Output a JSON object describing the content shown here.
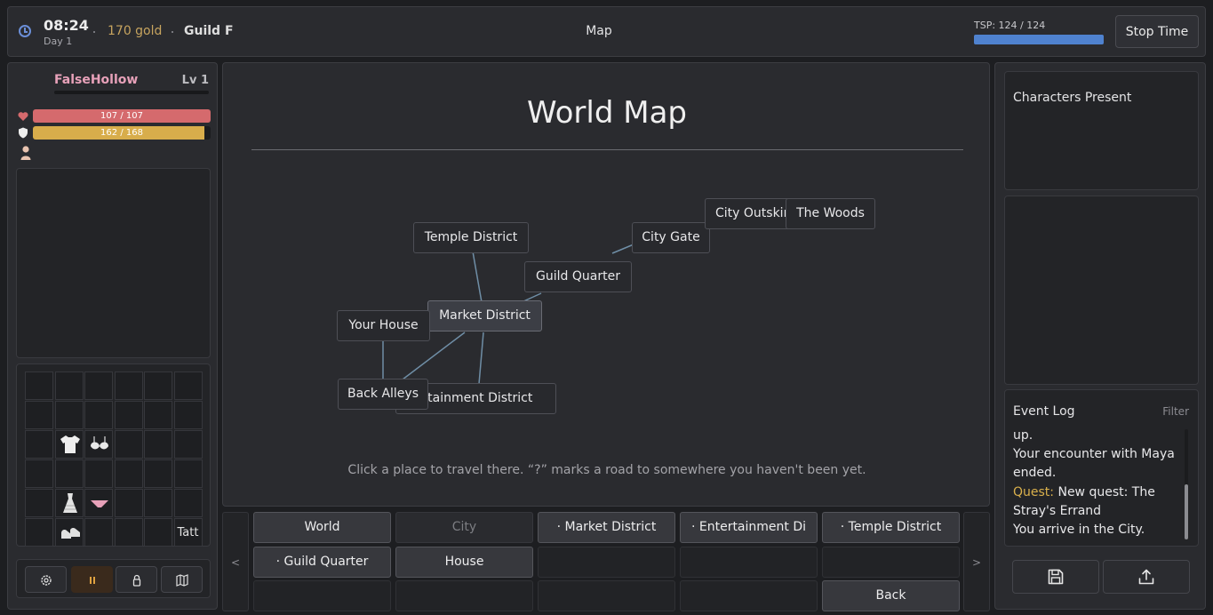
{
  "topbar": {
    "time": "08:24",
    "day": "Day 1",
    "gold": "170 gold",
    "guild": "Guild F",
    "screen_title": "Map",
    "tsp_label": "TSP: 124 / 124",
    "tsp_fraction": 1.0,
    "stop_time_label": "Stop Time"
  },
  "player": {
    "name": "FalseHollow",
    "level": "Lv 1",
    "hp_text": "107 / 107",
    "hp_fraction": 1.0,
    "stamina_text": "162 / 168",
    "stamina_fraction": 0.964
  },
  "inventory": {
    "items": [
      "shirt-icon",
      "bra-icon",
      "dress-icon",
      "panties-icon",
      "shoes-icon"
    ],
    "tattoo_label": "Tatt"
  },
  "map": {
    "title": "World Map",
    "hint": "Click a place to travel there.  “?” marks a road to somewhere you haven't been yet.",
    "current_location": "Market District",
    "nodes": {
      "temple": "Temple District",
      "city_gate": "City Gate",
      "city_outskirts": "City Outskirts",
      "woods": "The Woods",
      "guild_quarter": "Guild Quarter",
      "market": "Market District",
      "your_house": "Your House",
      "back_alleys": "Back Alleys",
      "entertainment": "Entertainment District"
    }
  },
  "tabs": {
    "prev": "<",
    "next": ">",
    "world": "World",
    "city": "City",
    "market": "· Market District",
    "entertainment": "· Entertainment Di",
    "temple": "· Temple District",
    "guild_quarter": "· Guild Quarter",
    "house": "House",
    "back": "Back"
  },
  "right": {
    "characters_title": "Characters Present",
    "event_log_title": "Event Log",
    "filter_label": "Filter",
    "log": {
      "line1": "up.",
      "line2": "Your encounter with Maya ended.",
      "quest_tag": "Quest:",
      "quest_text": " New quest: The Stray's Errand",
      "line4": "You arrive in the City."
    }
  },
  "colors": {
    "accent_blue": "#4f82cf",
    "hp_red": "#d56a6d",
    "stamina_gold": "#d8ad4b",
    "gold_text": "#c7a45f",
    "player_name_pink": "#e7a1b9",
    "quest_yellow": "#d9b04c"
  }
}
